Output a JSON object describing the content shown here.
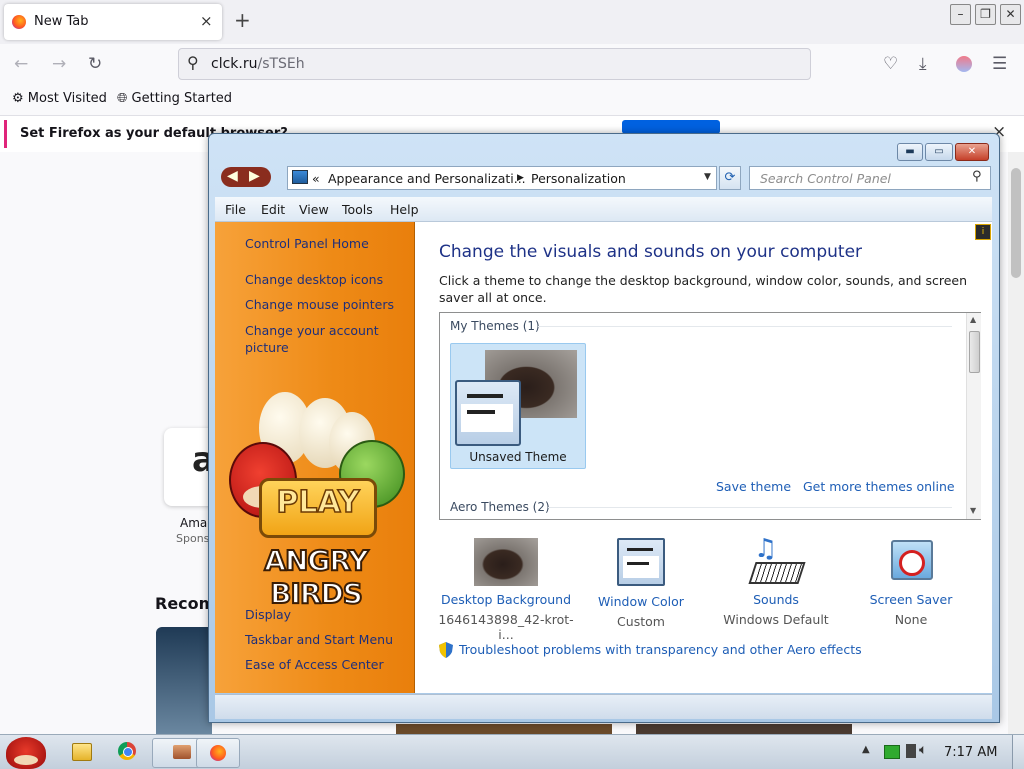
{
  "browser": {
    "tab_title": "New Tab",
    "tab_close": "×",
    "new_tab": "+",
    "url_host": "clck.ru",
    "url_path": "/sTSEh",
    "bookmarks": [
      "Most Visited",
      "Getting Started"
    ],
    "notification": "Set Firefox as your default browser?",
    "notification_close": "×",
    "page": {
      "tile_label": "Ama",
      "tile_sub": "Spons",
      "section": "Recom"
    }
  },
  "control_panel": {
    "breadcrumb_prefix": "«",
    "breadcrumb": [
      "Appearance and Personalizati...",
      "Personalization"
    ],
    "search_placeholder": "Search Control Panel",
    "menu": [
      "File",
      "Edit",
      "View",
      "Tools",
      "Help"
    ],
    "sidebar_links": [
      "Control Panel Home",
      "Change desktop icons",
      "Change mouse pointers",
      "Change your account picture"
    ],
    "sidebar_see_also": [
      "Display",
      "Taskbar and Start Menu",
      "Ease of Access Center"
    ],
    "heading": "Change the visuals and sounds on your computer",
    "description": "Click a theme to change the desktop background, window color, sounds, and screen saver all at once.",
    "my_themes_label": "My Themes (1)",
    "theme_name": "Unsaved Theme",
    "save_theme": "Save theme",
    "get_more_themes": "Get more themes online",
    "aero_themes_label": "Aero Themes (2)",
    "bottom_items": [
      {
        "label": "Desktop Background",
        "sub": "1646143898_42-krot-i..."
      },
      {
        "label": "Window Color",
        "sub": "Custom"
      },
      {
        "label": "Sounds",
        "sub": "Windows Default"
      },
      {
        "label": "Screen Saver",
        "sub": "None"
      }
    ],
    "troubleshoot": "Troubleshoot problems with transparency and other Aero effects",
    "ad_text": {
      "play": "PLAY",
      "brand": "ANGRY BIRDS"
    }
  },
  "taskbar": {
    "clock": "7:17 AM"
  },
  "colors": {
    "accent": "#0061e0",
    "link": "#1e5eb6",
    "sidebar_orange": "#ee8a16"
  }
}
